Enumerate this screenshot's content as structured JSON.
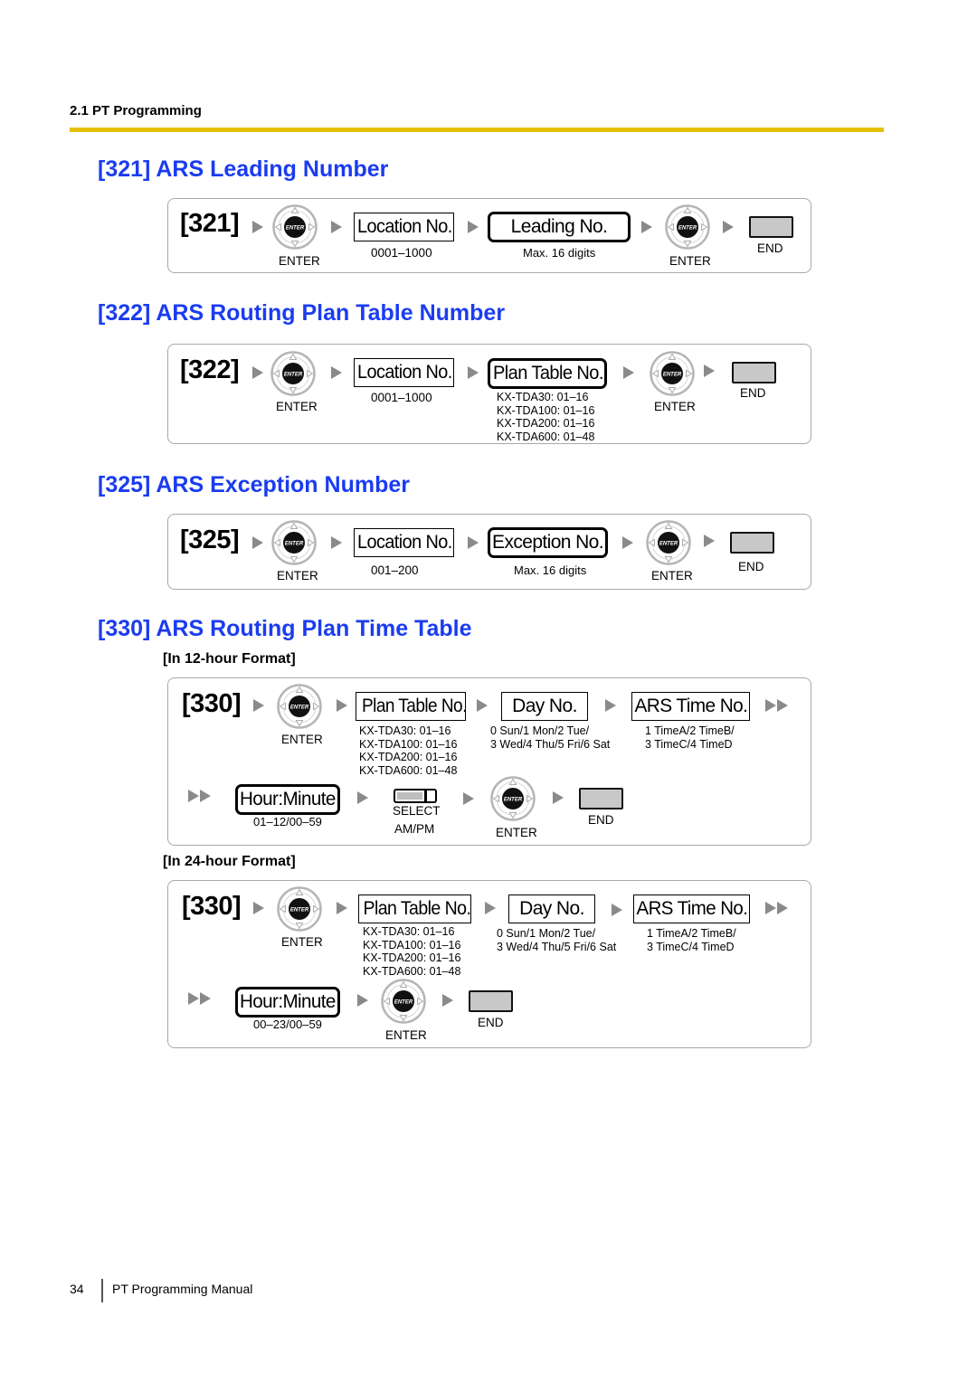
{
  "header": {
    "section": "2.1 PT Programming"
  },
  "common": {
    "enter_label": "ENTER",
    "end_label": "END",
    "enter_key_text": "ENTER"
  },
  "sections": [
    {
      "title": "[321] ARS Leading Number",
      "code": "[321]",
      "steps": [
        {
          "label": "Location No.",
          "desc": [
            "0001–1000"
          ]
        },
        {
          "label": "Leading No.",
          "desc": [
            "Max. 16 digits"
          ]
        }
      ]
    },
    {
      "title": "[322] ARS Routing Plan Table Number",
      "code": "[322]",
      "steps": [
        {
          "label": "Location No.",
          "desc": [
            "0001–1000"
          ]
        },
        {
          "label": "Plan Table No.",
          "desc": [
            "KX-TDA30: 01–16",
            "KX-TDA100: 01–16",
            "KX-TDA200: 01–16",
            "KX-TDA600: 01–48"
          ]
        }
      ]
    },
    {
      "title": "[325] ARS Exception Number",
      "code": "[325]",
      "steps": [
        {
          "label": "Location No.",
          "desc": [
            "001–200"
          ]
        },
        {
          "label": "Exception No.",
          "desc": [
            "Max. 16 digits"
          ]
        }
      ]
    },
    {
      "title": "[330] ARS Routing Plan Time Table",
      "formats": [
        {
          "subtitle": "[In 12-hour Format]",
          "code": "[330]",
          "steps": [
            {
              "label": "Plan Table No.",
              "desc": [
                "KX-TDA30: 01–16",
                "KX-TDA100: 01–16",
                "KX-TDA200: 01–16",
                "KX-TDA600: 01–48"
              ]
            },
            {
              "label": "Day No.",
              "desc": [
                "0 Sun/1 Mon/2 Tue/",
                "3 Wed/4 Thu/5 Fri/6 Sat"
              ]
            },
            {
              "label": "ARS Time No.",
              "desc": [
                "1 TimeA/2 TimeB/",
                "3 TimeC/4 TimeD"
              ]
            },
            {
              "label": "Hour:Minute",
              "desc": [
                "01–12/00–59"
              ]
            }
          ],
          "select_label": "SELECT",
          "select_desc": "AM/PM"
        },
        {
          "subtitle": "[In 24-hour Format]",
          "code": "[330]",
          "steps": [
            {
              "label": "Plan Table No.",
              "desc": [
                "KX-TDA30: 01–16",
                "KX-TDA100: 01–16",
                "KX-TDA200: 01–16",
                "KX-TDA600: 01–48"
              ]
            },
            {
              "label": "Day No.",
              "desc": [
                "0 Sun/1 Mon/2 Tue/",
                "3 Wed/4 Thu/5 Fri/6 Sat"
              ]
            },
            {
              "label": "ARS Time No.",
              "desc": [
                "1 TimeA/2 TimeB/",
                "3 TimeC/4 TimeD"
              ]
            },
            {
              "label": "Hour:Minute",
              "desc": [
                "00–23/00–59"
              ]
            }
          ]
        }
      ]
    }
  ],
  "footer": {
    "page": "34",
    "title": "PT Programming Manual"
  }
}
